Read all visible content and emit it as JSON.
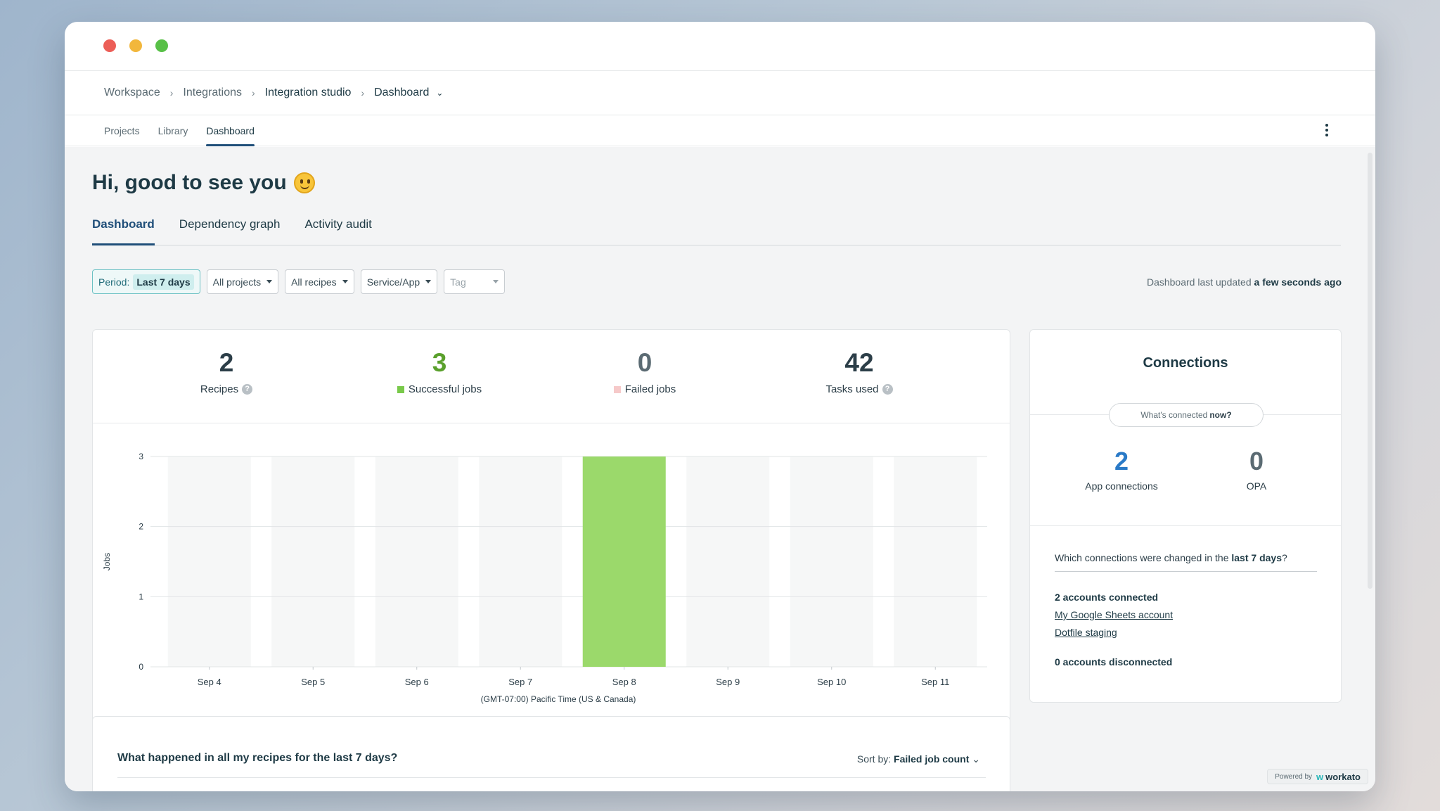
{
  "breadcrumb": {
    "items": [
      "Workspace",
      "Integrations",
      "Integration studio",
      "Dashboard"
    ]
  },
  "subnav": {
    "items": [
      "Projects",
      "Library",
      "Dashboard"
    ],
    "active": "Dashboard"
  },
  "greeting": "Hi, good to see you",
  "tabs": {
    "items": [
      "Dashboard",
      "Dependency graph",
      "Activity audit"
    ],
    "active": "Dashboard"
  },
  "filters": {
    "period_label": "Period:",
    "period_value": "Last 7 days",
    "projects": "All projects",
    "recipes": "All recipes",
    "service": "Service/App",
    "tag_placeholder": "Tag"
  },
  "updated": {
    "prefix": "Dashboard last updated",
    "value": "a few seconds ago"
  },
  "stats": {
    "recipes": {
      "value": "2",
      "label": "Recipes"
    },
    "successful": {
      "value": "3",
      "label": "Successful jobs"
    },
    "failed": {
      "value": "0",
      "label": "Failed jobs"
    },
    "tasks": {
      "value": "42",
      "label": "Tasks used"
    }
  },
  "colors": {
    "success": "#9bd96b",
    "failed": "#f6c9c9",
    "accent": "#1f4e79",
    "link": "#2a7ac7"
  },
  "chart_data": {
    "type": "bar",
    "categories": [
      "Sep 4",
      "Sep 5",
      "Sep 6",
      "Sep 7",
      "Sep 8",
      "Sep 9",
      "Sep 10",
      "Sep 11"
    ],
    "series": [
      {
        "name": "Successful jobs",
        "values": [
          0,
          0,
          0,
          0,
          3,
          0,
          0,
          0
        ]
      },
      {
        "name": "Failed jobs",
        "values": [
          0,
          0,
          0,
          0,
          0,
          0,
          0,
          0
        ]
      }
    ],
    "ylabel": "Jobs",
    "xlabel": "(GMT-07:00) Pacific Time (US & Canada)",
    "yticks": [
      0,
      1,
      2,
      3
    ],
    "ylim": [
      0,
      3
    ],
    "grid": true
  },
  "recipes_section": {
    "title": "What happened in all my recipes for the last 7 days?",
    "sort_prefix": "Sort by:",
    "sort_value": "Failed job count"
  },
  "connections": {
    "title": "Connections",
    "pill_text": "What's connected",
    "pill_bold": "now?",
    "app_connections": {
      "value": "2",
      "label": "App connections"
    },
    "opa": {
      "value": "0",
      "label": "OPA"
    },
    "question_prefix": "Which connections were changed in the",
    "question_bold": "last 7 days",
    "question_suffix": "?",
    "connected_header": "2 accounts connected",
    "accounts": [
      "My Google Sheets account",
      "Dotfile staging"
    ],
    "disconnected_header": "0 accounts disconnected"
  },
  "footer": {
    "powered_by": "Powered by",
    "brand": "workato"
  }
}
